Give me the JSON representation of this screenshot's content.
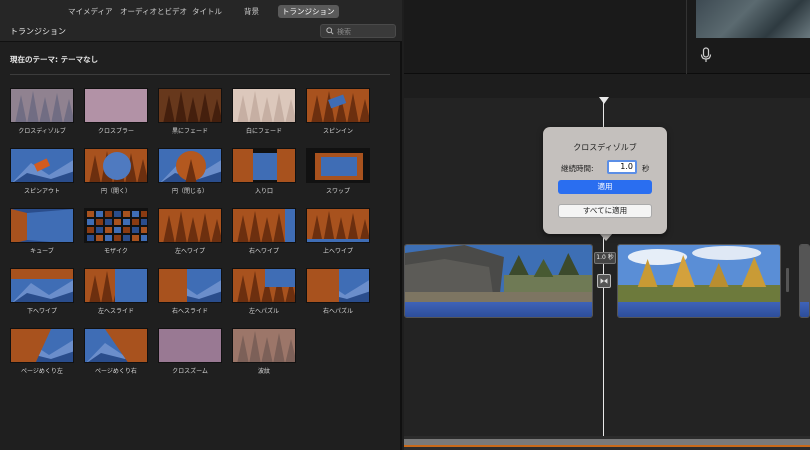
{
  "nav": {
    "tabs": [
      {
        "label": "マイメディア",
        "active": false
      },
      {
        "label": "オーディオとビデオ",
        "active": false
      },
      {
        "label": "タイトル",
        "active": false
      },
      {
        "label": "背景",
        "active": false
      },
      {
        "label": "トランジション",
        "active": true
      }
    ]
  },
  "panel": {
    "title": "トランジション",
    "search_placeholder": "検索",
    "theme_label": "現在のテーマ: テーマなし"
  },
  "transitions": [
    {
      "label": "クロスディゾルブ",
      "style": "dissolve"
    },
    {
      "label": "クロスブラー",
      "style": "blur"
    },
    {
      "label": "黒にフェード",
      "style": "fadeblack"
    },
    {
      "label": "白にフェード",
      "style": "fadewhite"
    },
    {
      "label": "スピンイン",
      "style": "spinin"
    },
    {
      "label": "スピンアウト",
      "style": "spinout"
    },
    {
      "label": "円（開く）",
      "style": "circleopen"
    },
    {
      "label": "円（閉じる）",
      "style": "circleclose"
    },
    {
      "label": "入り口",
      "style": "doorway"
    },
    {
      "label": "スワップ",
      "style": "swap"
    },
    {
      "label": "キューブ",
      "style": "cube"
    },
    {
      "label": "モザイク",
      "style": "mosaic"
    },
    {
      "label": "左へワイプ",
      "style": "wipeleft"
    },
    {
      "label": "右へワイプ",
      "style": "wiperight"
    },
    {
      "label": "上へワイプ",
      "style": "wipeup"
    },
    {
      "label": "下へワイプ",
      "style": "wipedown"
    },
    {
      "label": "左へスライド",
      "style": "slideleft"
    },
    {
      "label": "右へスライド",
      "style": "slideright"
    },
    {
      "label": "左へパズル",
      "style": "puzzleleft"
    },
    {
      "label": "右へパズル",
      "style": "puzzleright"
    },
    {
      "label": "ページめくり左",
      "style": "pageleft"
    },
    {
      "label": "ページめくり右",
      "style": "pageright"
    },
    {
      "label": "クロスズーム",
      "style": "crosszoom"
    },
    {
      "label": "波紋",
      "style": "ripple"
    }
  ],
  "timeline": {
    "transition_badge": "1.0 秒"
  },
  "popover": {
    "title": "クロスディゾルブ",
    "duration_label": "継続時間:",
    "duration_value": "1.0",
    "duration_unit": "秒",
    "apply_label": "適用",
    "apply_all_label": "すべてに適用"
  },
  "colors": {
    "accent": "#2a6ef0",
    "timeline_audio": "#3f63b8",
    "scroll_line": "#c96a1a"
  }
}
